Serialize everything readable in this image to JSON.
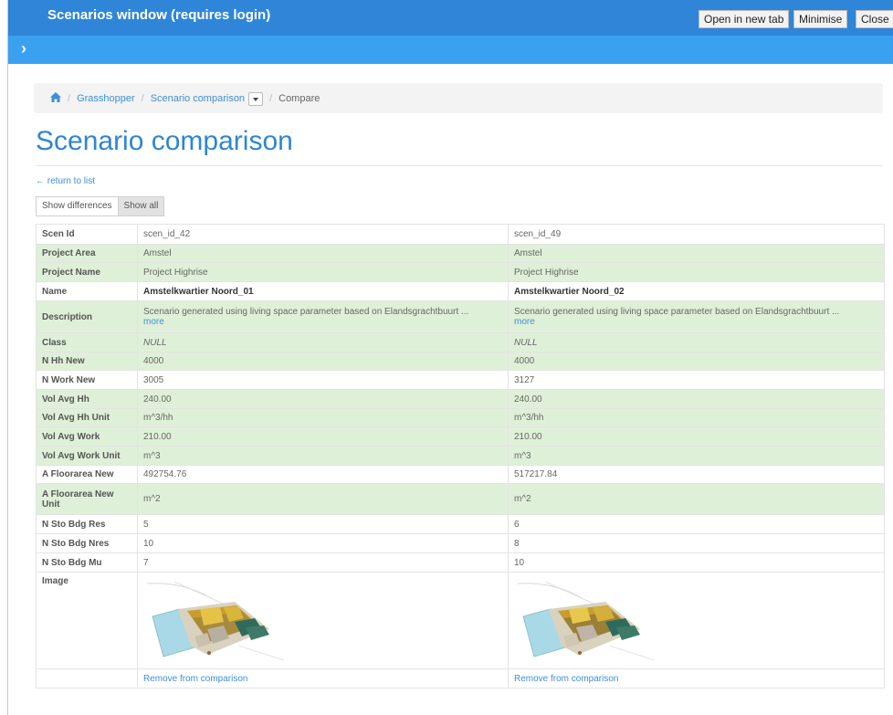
{
  "window": {
    "title": "Scenarios window (requires login)",
    "buttons": [
      "Open in new tab",
      "Minimise",
      "Close"
    ]
  },
  "breadcrumb": {
    "items": [
      "Grasshopper",
      "Scenario comparison"
    ],
    "current": "Compare"
  },
  "page_title": "Scenario comparison",
  "back_link": "← return to list",
  "toggle": {
    "show_differences": "Show differences",
    "show_all": "Show all",
    "active": "Show all"
  },
  "table": {
    "rows": [
      {
        "label": "Scen Id",
        "a": "scen_id_42",
        "b": "scen_id_49",
        "diff": false
      },
      {
        "label": "Project Area",
        "a": "Amstel",
        "b": "Amstel",
        "diff": false
      },
      {
        "label": "Project Name",
        "a": "Project Highrise",
        "b": "Project Highrise",
        "diff": false
      },
      {
        "label": "Name",
        "a": "Amstelkwartier Noord_01",
        "b": "Amstelkwartier Noord_02",
        "diff": true
      },
      {
        "label": "Description",
        "a": "Scenario generated using living space parameter based on Elandsgrachtbuurt ...",
        "b": "Scenario generated using living space parameter based on Elandsgrachtbuurt ...",
        "more": "more",
        "diff": false
      },
      {
        "label": "Class",
        "a": "NULL",
        "b": "NULL",
        "diff": false
      },
      {
        "label": "N Hh New",
        "a": "4000",
        "b": "4000",
        "diff": false
      },
      {
        "label": "N Work New",
        "a": "3005",
        "b": "3127",
        "diff": true
      },
      {
        "label": "Vol Avg Hh",
        "a": "240.00",
        "b": "240.00",
        "diff": false
      },
      {
        "label": "Vol Avg Hh Unit",
        "a": "m^3/hh",
        "b": "m^3/hh",
        "diff": false
      },
      {
        "label": "Vol Avg Work",
        "a": "210.00",
        "b": "210.00",
        "diff": false
      },
      {
        "label": "Vol Avg Work Unit",
        "a": "m^3",
        "b": "m^3",
        "diff": false
      },
      {
        "label": "A Floorarea New",
        "a": "492754.76",
        "b": "517217.84",
        "diff": true
      },
      {
        "label": "A Floorarea New Unit",
        "a": "m^2",
        "b": "m^2",
        "diff": false
      },
      {
        "label": "N Sto Bdg Res",
        "a": "5",
        "b": "6",
        "diff": true
      },
      {
        "label": "N Sto Bdg Nres",
        "a": "10",
        "b": "8",
        "diff": true
      },
      {
        "label": "N Sto Bdg Mu",
        "a": "7",
        "b": "10",
        "diff": true
      }
    ],
    "image_label": "Image",
    "remove_label": "Remove from comparison"
  }
}
